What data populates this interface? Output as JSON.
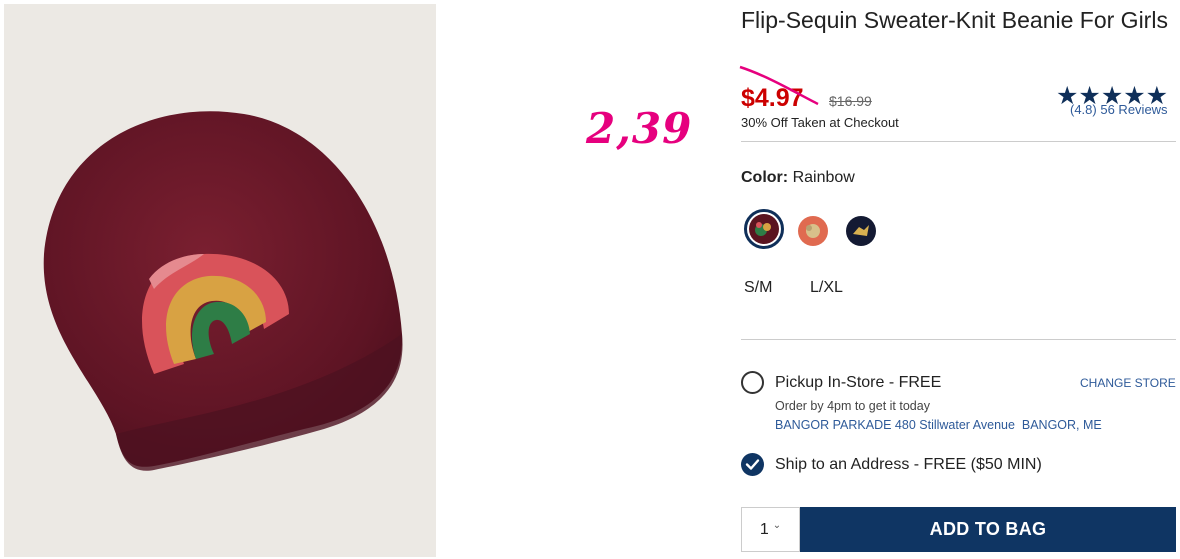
{
  "product": {
    "title": "Flip-Sequin Sweater-Knit Beanie For Girls",
    "image_alt": "beanie photo"
  },
  "annotation": {
    "price": "2,39",
    "color": "#e6007e"
  },
  "price": {
    "sale": "$4.97",
    "regular": "$16.99",
    "checkout_note": "30% Off Taken at Checkout"
  },
  "rating": {
    "stars": "★★★★★",
    "score": "(4.8)",
    "reviews": "56 Reviews",
    "value": 4.8
  },
  "color_selector": {
    "label": "Color:",
    "selected": "Rainbow",
    "swatches": [
      {
        "name": "Rainbow",
        "bg": "#5a1420"
      },
      {
        "name": "Coral",
        "bg": "#e06a50"
      },
      {
        "name": "Navy",
        "bg": "#141a33"
      }
    ]
  },
  "sizes": [
    "S/M",
    "L/XL"
  ],
  "fulfillment": {
    "pickup": {
      "label": "Pickup In-Store - FREE",
      "note": "Order by 4pm to get it today",
      "store": "BANGOR PARKADE 480 Stillwater Avenue  BANGOR, ME",
      "change_store": "CHANGE STORE",
      "selected": false
    },
    "ship": {
      "label": "Ship to an Address - FREE ($50 MIN)",
      "selected": true
    }
  },
  "cart": {
    "quantity": "1",
    "add_to_bag": "ADD TO BAG"
  },
  "colors": {
    "brand_navy": "#0f3563",
    "sale_red": "#cc0000",
    "link_blue": "#2e5a99"
  }
}
